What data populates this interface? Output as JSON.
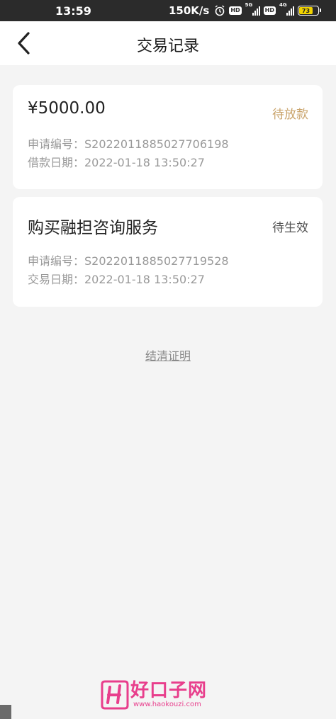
{
  "status_bar": {
    "time": "13:59",
    "net_speed": "150K/s",
    "hd_label": "HD",
    "sim1_label": "5G",
    "sim2_label": "4G",
    "battery_level": "73",
    "battery_color": "#f2d400"
  },
  "nav": {
    "title": "交易记录",
    "back_icon": "chevron-left-icon"
  },
  "records": [
    {
      "title": "¥5000.00",
      "status": "待放款",
      "status_color": "#c9a36a",
      "line1": "申请编号：S2022011885027706198",
      "line2": "借款日期：2022-01-18 13:50:27"
    },
    {
      "title": "购买融担咨询服务",
      "status": "待生效",
      "status_color": "#555555",
      "line1": "申请编号：S2022011885027719528",
      "line2": "交易日期：2022-01-18 13:50:27"
    }
  ],
  "settle_link": "结清证明",
  "watermark": {
    "cn": "好口子网",
    "url": "www.haokouzi.com",
    "color": "#e83e8c"
  }
}
